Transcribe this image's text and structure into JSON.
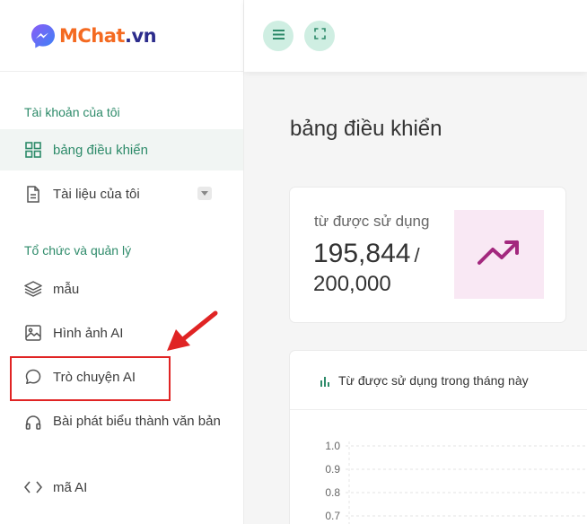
{
  "brand": {
    "logo_text_main": "MChat",
    "logo_text_suffix": ".vn",
    "colors": {
      "orange": "#f46a21",
      "navy": "#2c2c8c",
      "purple": "#6a5cf0"
    }
  },
  "topbar": {
    "menu_icon": "hamburger-icon",
    "fullscreen_icon": "expand-icon"
  },
  "sidebar": {
    "section_account": "Tài khoản của tôi",
    "items_account": [
      {
        "label": "bảng điều khiển",
        "icon": "grid-icon",
        "active": true
      },
      {
        "label": "Tài liệu của tôi",
        "icon": "document-icon",
        "active": false
      }
    ],
    "section_org": "Tổ chức và quản lý",
    "items_org": [
      {
        "label": "mẫu",
        "icon": "layers-icon"
      },
      {
        "label": "Hình ảnh AI",
        "icon": "image-icon"
      },
      {
        "label": "Trò chuyện AI",
        "icon": "chat-icon"
      },
      {
        "label": "Bài phát biểu thành văn bản",
        "icon": "headphones-icon"
      },
      {
        "label": "mã AI",
        "icon": "code-icon"
      }
    ]
  },
  "main": {
    "page_title": "bảng điều khiển",
    "stat": {
      "label": "từ được sử dụng",
      "used": "195,844",
      "separator": "/",
      "total": "200,000",
      "icon": "trending-up-icon"
    },
    "chart_card": {
      "title": "Từ được sử dụng trong tháng này",
      "icon": "bar-chart-icon"
    }
  },
  "chart_data": {
    "type": "bar",
    "title": "Từ được sử dụng trong tháng này",
    "ytick_labels": [
      "1.0",
      "0.9",
      "0.8",
      "0.7"
    ],
    "grid": true
  },
  "colors": {
    "accent": "#2e8b6a",
    "accent_light": "#cfeee2",
    "stat_icon_bg": "#f9e8f4",
    "stat_icon": "#a3287e",
    "highlight": "#e02424"
  }
}
